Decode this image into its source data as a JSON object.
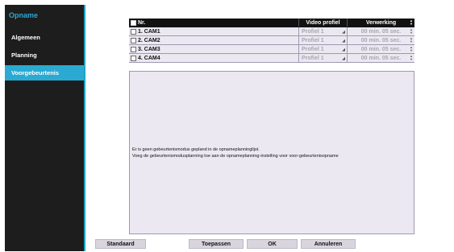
{
  "sidebar": {
    "title": "Opname",
    "items": [
      {
        "label": "Algemeen"
      },
      {
        "label": "Planning"
      },
      {
        "label": "Voorgebeurtenis"
      }
    ]
  },
  "table": {
    "headers": {
      "nr": "Nr.",
      "profile": "Video profiel",
      "processing": "Verwerking"
    },
    "rows": [
      {
        "camera": "1. CAM1",
        "profile": "Profiel 1",
        "time": "00 min. 05 sec."
      },
      {
        "camera": "2. CAM2",
        "profile": "Profiel 1",
        "time": "00 min. 05 sec."
      },
      {
        "camera": "3. CAM3",
        "profile": "Profiel 1",
        "time": "00 min. 05 sec."
      },
      {
        "camera": "4. CAM4",
        "profile": "Profiel 1",
        "time": "00 min. 05 sec."
      }
    ]
  },
  "message": {
    "line1": "Er is geen gebeurtenismodus gepland in de opnameplanninglijst.",
    "line2": "Voeg de gebeurtenismodusplanning toe aan de opnameplanning-instelling voor voor-gebeurtenisopname"
  },
  "buttons": {
    "default": "Standaard",
    "apply": "Toepassen",
    "ok": "OK",
    "cancel": "Annuleren"
  },
  "colors": {
    "accent": "#2aa9d2",
    "sidebar_bg": "#1d1d1d",
    "header_bg": "#121212",
    "row_bg": "#ebe8f1"
  }
}
